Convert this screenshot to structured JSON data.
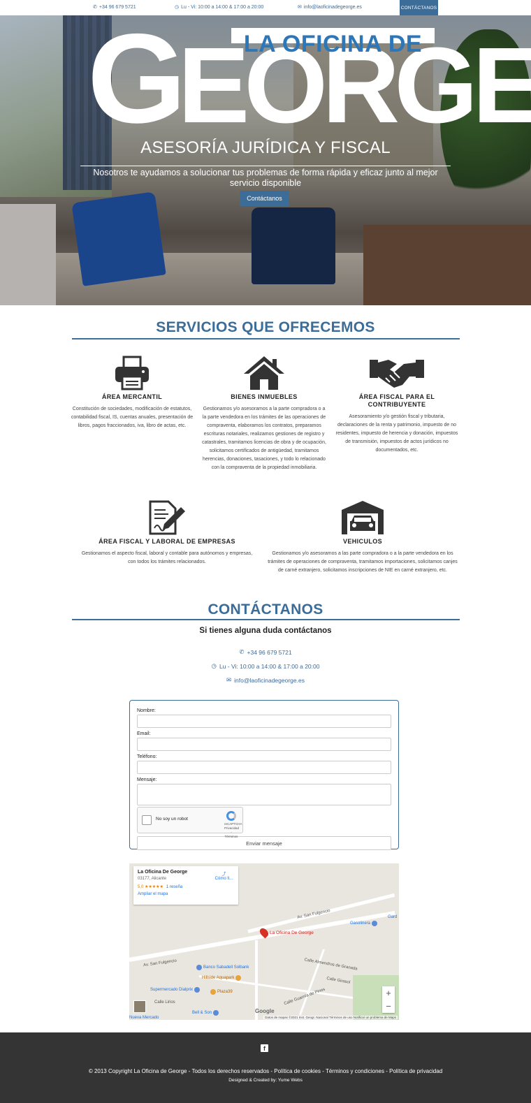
{
  "topbar": {
    "phone": "+34 96 679 5721",
    "hours": "Lu - Vi: 10:00 a 14:00 & 17:00 a 20:00",
    "email": "info@laoficinadegeorge.es",
    "cta": "CONTÁCTANOS"
  },
  "hero": {
    "logo_line1": "LA OFICINA DE",
    "logo_g": "G",
    "logo_rest": "EORGE",
    "subtitle": "ASESORÍA JURÍDICA Y FISCAL",
    "tagline": "Nosotros te ayudamos a solucionar tus problemas de forma rápida y eficaz junto al mejor servicio disponible",
    "button": "Contáctanos"
  },
  "services": {
    "title": "SERVICIOS QUE OFRECEMOS",
    "items": [
      {
        "icon": "printer-icon",
        "title": "ÁREA MERCANTIL",
        "text": "Constitución de sociedades, modificación de estatutos, contabilidad fiscal, IS, cuentas anuales, presentación de libros, pagos fraccionados, iva, libro de actas, etc."
      },
      {
        "icon": "house-icon",
        "title": "BIENES INMUEBLES",
        "text": "Gestionamos y/o asesoramos a la parte compradora o a la parte vendedora en los trámites de las operaciones de compraventa, elaboramos los contratos, preparamos escrituras notariales, realizamos gestiones de registro y catastrales, tramitamos licencias de obra y de ocupación, solicitamos certificados de antigüedad, tramitamos herencias, donaciones, tasaciones, y todo lo relacionado con la compraventa de la propiedad inmobiliaria."
      },
      {
        "icon": "handshake-icon",
        "title": "ÁREA FISCAL PARA EL CONTRIBUYENTE",
        "text": "Asesoramiento y/o gestión fiscal y tributaria, declaraciones de la renta y patrimonio, impuesto de no residentes, impuesto de herencia y donación, impuestos de transmisión, impuestos de actos jurídicos no documentados, etc."
      },
      {
        "icon": "document-sign-icon",
        "title": "ÁREA FISCAL Y LABORAL DE EMPRESAS",
        "text": "Gestionamos el aspecto fiscal, laboral y contable para autónomos y empresas, con todos los trámites relacionados."
      },
      {
        "icon": "garage-car-icon",
        "title": "VEHICULOS",
        "text": "Gestionamos y/o asesoramos a las parte compradora o a la parte vendedora en los trámites de operaciones de compraventa, tramitamos importaciones, solicitamos canjes de carné extranjero, solicitamos inscripciones de NIE en carné extranjero, etc."
      }
    ]
  },
  "contact": {
    "title": "CONTÁCTANOS",
    "lead": "Si tienes alguna duda contáctanos",
    "phone": "+34 96 679 5721",
    "hours": "Lu - Vi: 10:00 a 14:00 & 17:00 a 20:00",
    "email": "info@laoficinadegeorge.es"
  },
  "form": {
    "name_label": "Nombre:",
    "email_label": "Email:",
    "phone_label": "Teléfono:",
    "message_label": "Mensaje:",
    "captcha_label": "No soy un robot",
    "captcha_brand": "reCAPTCHA",
    "captcha_links": "Privacidad - Términos",
    "submit": "Enviar mensaje"
  },
  "map": {
    "place_name": "La Oficina De George",
    "address": "03177, Alicante",
    "rating": "5,0 ★★★★★",
    "reviews": "1 reseña",
    "expand": "Ampliar el mapa",
    "directions": "Cómo ll...",
    "pin_label": "La Oficina De George",
    "street1": "Av. San Fulgencio",
    "street2": "Av. San Fulgencio",
    "street3": "Calle Almendros de Granada",
    "street4": "Calle Girasol",
    "street5": "Calle Guarnía de Pinos",
    "street6": "Calle Lirios",
    "poi_bank": "Banco Sabadell Solbank",
    "poi_aquapark": "Hillside Aquapark",
    "poi_super": "Supermercado Dialprix",
    "poi_pizza": "Plaza39",
    "poi_bell": "Bell & Son",
    "poi_gas": "Gasolinera",
    "poi_gard": "Gard",
    "poi_mercado": "Nueva Mercado",
    "zoom_in": "+",
    "zoom_out": "−",
    "brand": "Google",
    "attribution": "Datos de mapas ©2021 Inst. Geogr. Nacional   Términos de uso   Notificar un problema de Maps"
  },
  "footer": {
    "facebook": "f",
    "copyright": "© 2013 Copyright La Oficina de George - Todos los derechos reservados - Política de cookies - Términos y condiciones - Política de privacidad",
    "credit": "Designed & Created by: Yume Webs"
  },
  "colors": {
    "accent": "#3b6d98",
    "footer_bg": "#343434",
    "logo_blue": "#2d77b8"
  }
}
